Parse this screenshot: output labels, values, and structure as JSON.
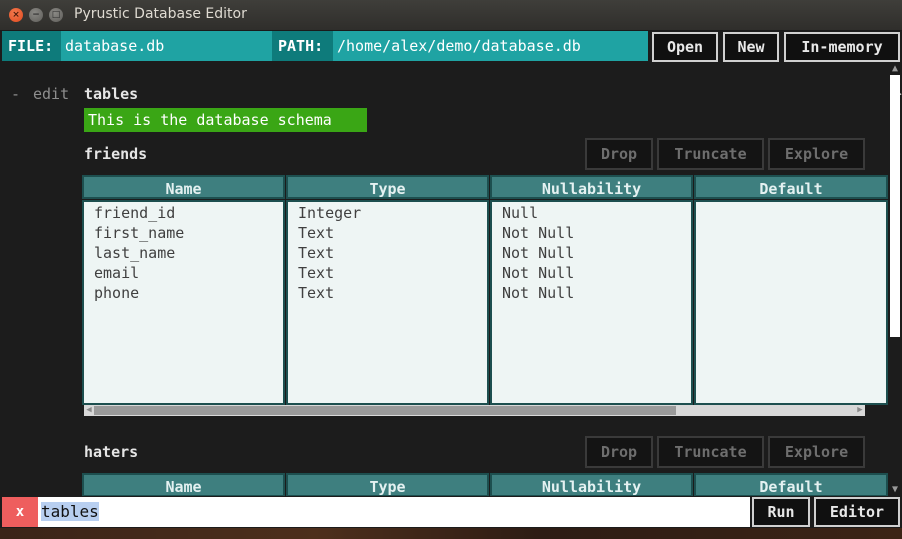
{
  "window": {
    "title": "Pyrustic Database Editor",
    "close_glyph": "×",
    "minimize_glyph": "−",
    "maximize_glyph": "□"
  },
  "header": {
    "file_label": "FILE:",
    "file_value": "database.db",
    "path_label": "PATH:",
    "path_value": "/home/alex/demo/database.db",
    "open_label": "Open",
    "new_label": "New",
    "inmemory_label": "In-memory"
  },
  "schema": {
    "toggle": "-",
    "edit_label": "edit",
    "name": "tables",
    "banner": "This is the database schema"
  },
  "tables": [
    {
      "name": "friends",
      "drop_label": "Drop",
      "truncate_label": "Truncate",
      "explore_label": "Explore",
      "columns": [
        "Name",
        "Type",
        "Nullability",
        "Default"
      ],
      "rows": [
        [
          "friend_id",
          "Integer",
          "Null",
          ""
        ],
        [
          "first_name",
          "Text",
          "Not Null",
          ""
        ],
        [
          "last_name",
          "Text",
          "Not Null",
          ""
        ],
        [
          "email",
          "Text",
          "Not Null",
          ""
        ],
        [
          "phone",
          "Text",
          "Not Null",
          ""
        ]
      ]
    },
    {
      "name": "haters",
      "drop_label": "Drop",
      "truncate_label": "Truncate",
      "explore_label": "Explore",
      "columns": [
        "Name",
        "Type",
        "Nullability",
        "Default"
      ]
    }
  ],
  "footer": {
    "clear_label": "x",
    "command_value": "tables",
    "run_label": "Run",
    "editor_label": "Editor"
  },
  "colors": {
    "file_label_bg": "#0e7b7b",
    "file_value_bg": "#1fa3a3",
    "banner_bg": "#3aa615",
    "column_header_bg": "#3e7f7f",
    "clear_button_bg": "#ee5e5e"
  }
}
